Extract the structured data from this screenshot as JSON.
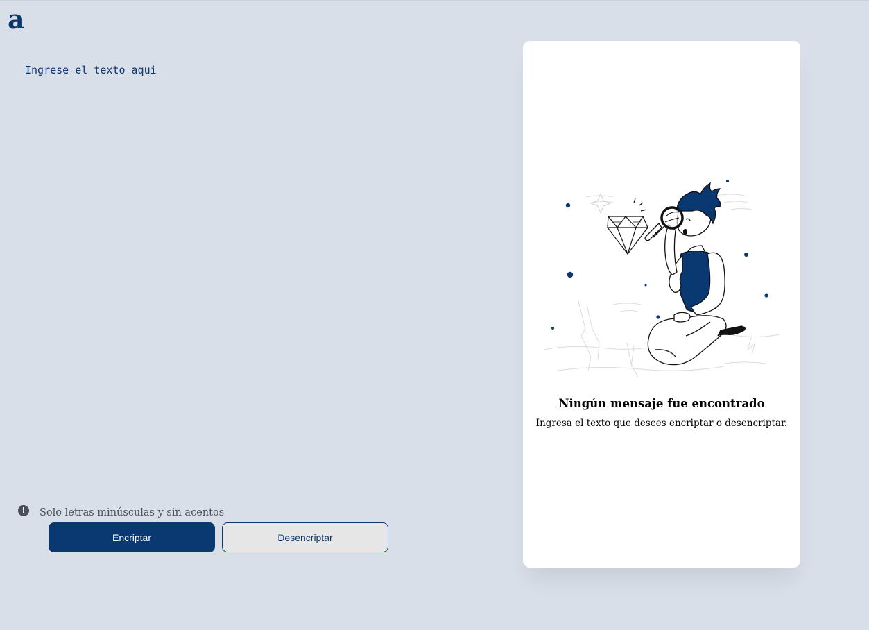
{
  "header": {
    "logo_text": "a"
  },
  "input": {
    "placeholder": "Ingrese el texto aqui",
    "value": ""
  },
  "hint": {
    "icon": "exclamation-icon",
    "text": "Solo letras minúsculas y sin acentos"
  },
  "actions": {
    "encrypt_label": "Encriptar",
    "decrypt_label": "Desencriptar"
  },
  "output_panel": {
    "illustration": "person-with-magnifying-glass-and-diamond",
    "title": "Ningún mensaje fue encontrado",
    "description": "Ingresa el texto que desees encriptar o desencriptar."
  },
  "colors": {
    "background": "#d8dfe9",
    "brand": "#0a3871",
    "panel": "#ffffff",
    "hint": "#495057",
    "secondary_button_bg": "#e6e6e6"
  }
}
